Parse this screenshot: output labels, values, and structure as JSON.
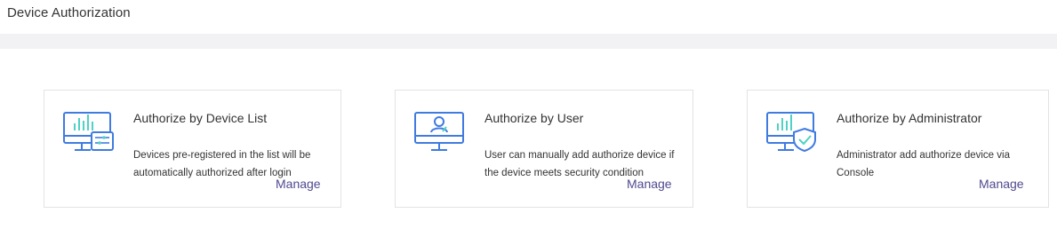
{
  "header": {
    "title": "Device Authorization"
  },
  "cards": [
    {
      "title": "Authorize by Device List",
      "description": "Devices pre-registered in the list will be automatically authorized after login",
      "action_label": "Manage",
      "icon": "monitor-list-icon"
    },
    {
      "title": "Authorize by User",
      "description": "User can manually add authorize device if the device meets security condition",
      "action_label": "Manage",
      "icon": "monitor-user-icon"
    },
    {
      "title": "Authorize by Administrator",
      "description": "Administrator add authorize device via Console",
      "action_label": "Manage",
      "icon": "monitor-shield-icon"
    }
  ],
  "colors": {
    "icon_blue": "#3f7be0",
    "icon_teal": "#4fd1c5",
    "link": "#4f4a8f",
    "band": "#f2f2f4",
    "border": "#e3e3e6"
  }
}
